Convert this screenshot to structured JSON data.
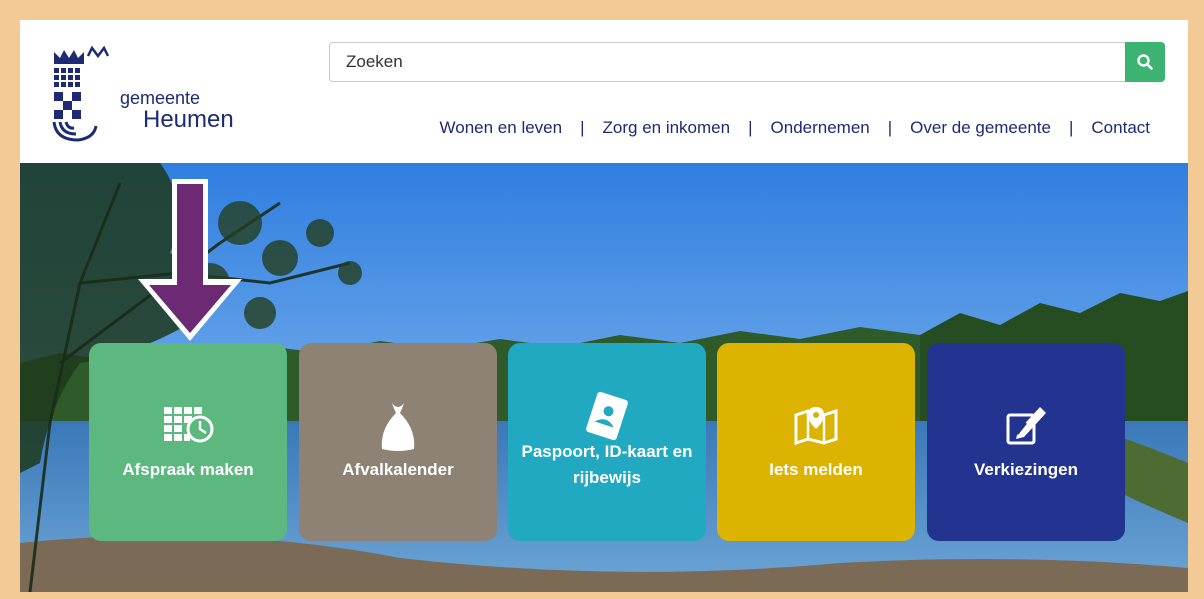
{
  "logo": {
    "line1": "gemeente",
    "line2": "Heumen"
  },
  "search": {
    "placeholder": "Zoeken"
  },
  "nav": {
    "items": [
      {
        "label": "Wonen en leven"
      },
      {
        "label": "Zorg en inkomen"
      },
      {
        "label": "Ondernemen"
      },
      {
        "label": "Over de gemeente"
      },
      {
        "label": "Contact"
      }
    ],
    "separator": "|"
  },
  "tiles": [
    {
      "label": "Afspraak maken",
      "color": "#5cb87f",
      "icon": "calendar-clock-icon"
    },
    {
      "label": "Afvalkalender",
      "color": "#8d8273",
      "icon": "garbage-bag-icon"
    },
    {
      "label": "Paspoort, ID-kaart en rijbewijs",
      "color": "#21a9c1",
      "icon": "passport-icon"
    },
    {
      "label": "Iets melden",
      "color": "#dcb300",
      "icon": "map-pin-icon"
    },
    {
      "label": "Verkiezingen",
      "color": "#233390",
      "icon": "vote-pencil-icon"
    }
  ],
  "colors": {
    "brand": "#1d2b74",
    "search_button": "#3cb371",
    "frame": "#f3c996",
    "arrow": "#6b2a73"
  }
}
